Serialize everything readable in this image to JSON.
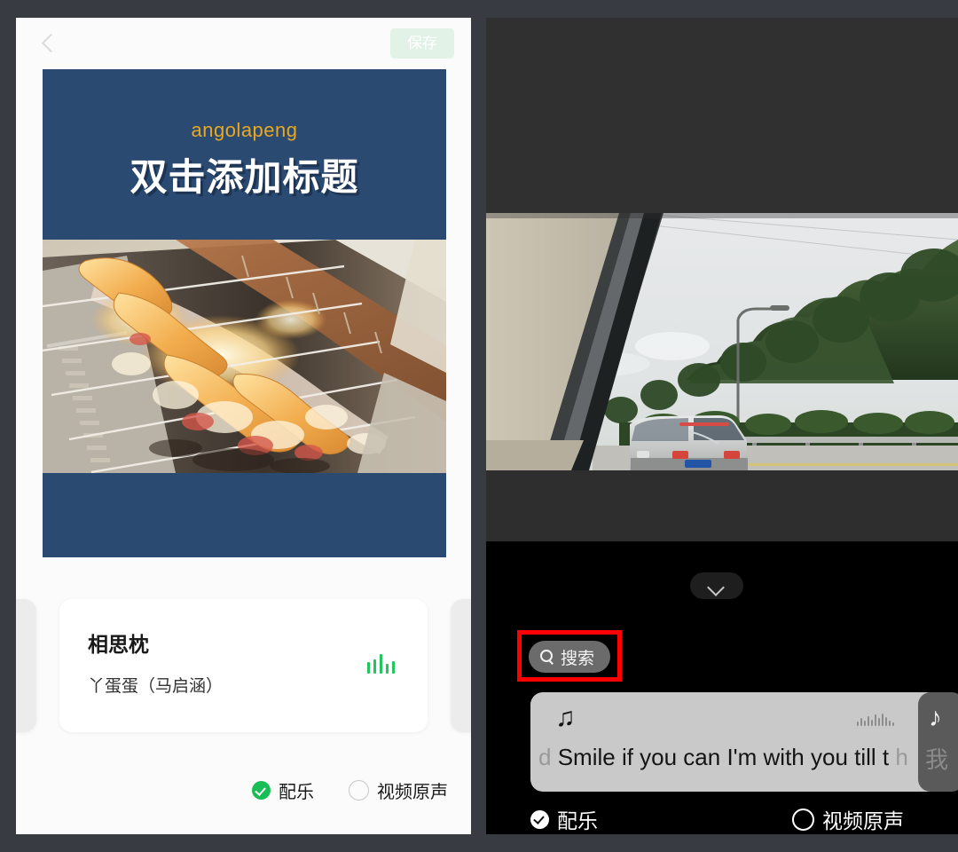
{
  "app": {
    "backdrop_color": "#383c42"
  },
  "left_panel": {
    "theme": "light",
    "topbar": {
      "back_icon": "chevron-left-icon",
      "save_label": "保存"
    },
    "preview": {
      "subtitle": "angolapeng",
      "title": "双击添加标题",
      "background_color": "#2a4a72",
      "accent_color": "#e8a822",
      "photo_alt": "烧烤架上的肉串"
    },
    "music_card": {
      "song_title": "相思枕",
      "artist": "丫蛋蛋（马启涵）",
      "equalizer_icon": "equalizer-icon",
      "equalizer_color": "#22c55e"
    },
    "audio_options": [
      {
        "label": "配乐",
        "selected": true
      },
      {
        "label": "视频原声",
        "selected": false
      }
    ]
  },
  "right_panel": {
    "theme": "dark",
    "collapse_icon": "chevron-down-icon",
    "search": {
      "icon": "search-icon",
      "label": "搜索",
      "highlighted": true,
      "highlight_color": "#ff0000"
    },
    "video_alt": "车窗外的公路与面包车",
    "music_card": {
      "note_icon": "music-note-icon",
      "waveform_icon": "waveform-icon",
      "lyric_lead": "d",
      "lyric_main": "Smile if you can   I'm with you till t",
      "lyric_tail": "h"
    },
    "next_card": {
      "note_icon": "music-note-icon",
      "partial_char": "我"
    },
    "audio_options": [
      {
        "label": "配乐",
        "selected": true
      },
      {
        "label": "视频原声",
        "selected": false
      }
    ]
  }
}
